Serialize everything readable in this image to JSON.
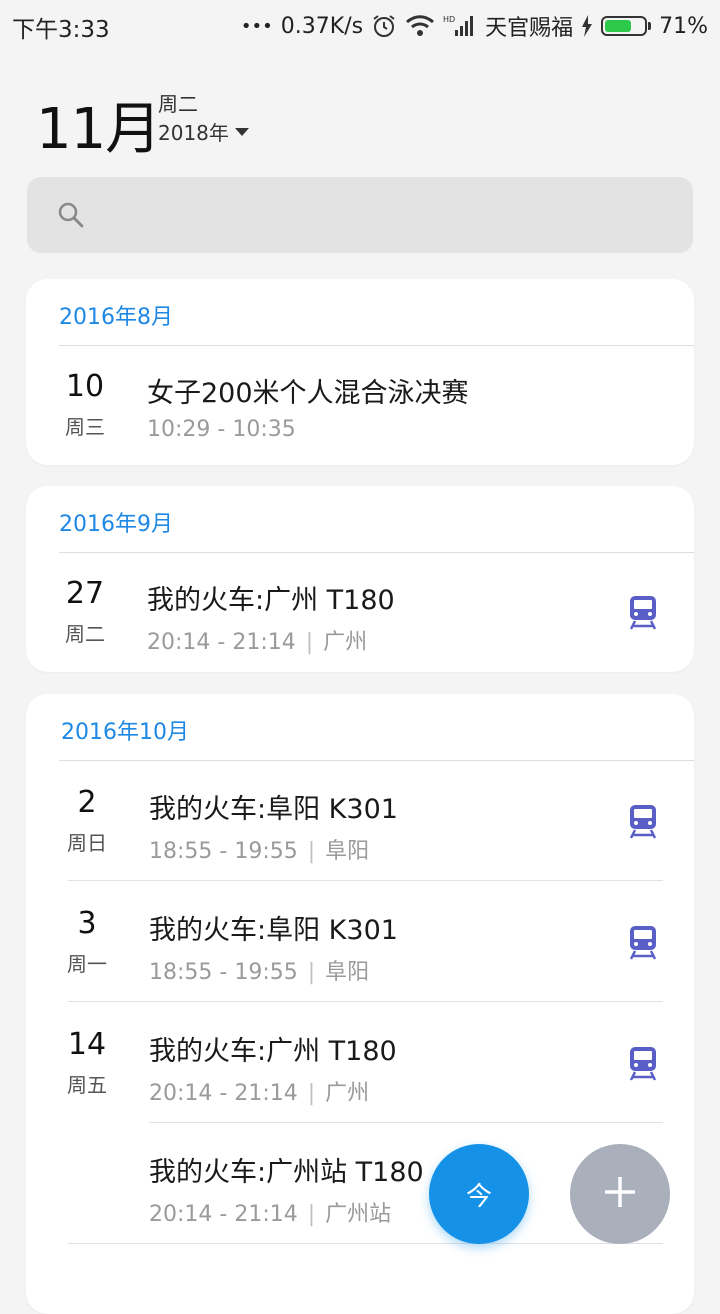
{
  "status_bar": {
    "time": "下午3:33",
    "dots": "•••",
    "speed": "0.37K/s",
    "carrier": "天官赐福",
    "battery_text": "71%",
    "battery_level": 0.71,
    "battery_color": "#2ec94b",
    "icons": [
      "alarm-icon",
      "wifi-icon",
      "hd-signal-icon",
      "charging-icon",
      "battery-icon"
    ]
  },
  "header": {
    "month": "11月",
    "weekday": "周二",
    "year": "2018年"
  },
  "search": {
    "placeholder": "",
    "icon": "search-icon"
  },
  "groups": [
    {
      "title": "2016年8月",
      "events": [
        {
          "day": "10",
          "weekday": "周三",
          "title": "女子200米个人混合泳决赛",
          "time": "10:29 - 10:35",
          "place": "",
          "icon": ""
        }
      ]
    },
    {
      "title": "2016年9月",
      "events": [
        {
          "day": "27",
          "weekday": "周二",
          "title": "我的火车:广州 T180",
          "time": "20:14 - 21:14",
          "place": "广州",
          "icon": "train-icon"
        }
      ]
    },
    {
      "title": "2016年10月",
      "events": [
        {
          "day": "2",
          "weekday": "周日",
          "title": "我的火车:阜阳 K301",
          "time": "18:55 - 19:55",
          "place": "阜阳",
          "icon": "train-icon"
        },
        {
          "day": "3",
          "weekday": "周一",
          "title": "我的火车:阜阳 K301",
          "time": "18:55 - 19:55",
          "place": "阜阳",
          "icon": "train-icon"
        },
        {
          "day": "14",
          "weekday": "周五",
          "title": "我的火车:广州 T180",
          "time": "20:14 - 21:14",
          "place": "广州",
          "icon": "train-icon"
        },
        {
          "day": "",
          "weekday": "",
          "title": "我的火车:广州站 T180",
          "time": "20:14 - 21:14",
          "place": "广州站",
          "icon": ""
        }
      ]
    }
  ],
  "fab": {
    "today_label": "今",
    "add_icon": "plus-icon"
  },
  "colors": {
    "accent": "#1e88e5",
    "train_icon": "#5a5fc8",
    "fab_today": "#1592e8",
    "fab_add": "#a9afbb"
  }
}
